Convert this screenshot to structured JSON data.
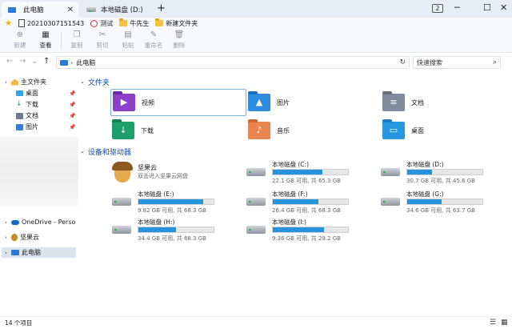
{
  "tabs": [
    {
      "label": "此电脑",
      "active": true
    },
    {
      "label": "本地磁盘 (D:)",
      "active": false
    }
  ],
  "tab_count": "2",
  "quick_access": [
    "20210307151543",
    "测试",
    "牛先生",
    "新建文件夹"
  ],
  "toolbar": {
    "new": "新建",
    "view": "查看",
    "copy": "复制",
    "cut": "剪切",
    "paste": "粘贴",
    "rename": "重命名",
    "delete": "删除"
  },
  "address": {
    "path": "此电脑",
    "search_placeholder": "快速搜索"
  },
  "sidebar": {
    "home": "主文件夹",
    "pinned": [
      "桌面",
      "下载",
      "文档",
      "图片"
    ],
    "onedrive": "OneDrive - Personal",
    "nutstore": "坚果云",
    "this_pc": "此电脑"
  },
  "groups": {
    "folders": "文件夹",
    "drives": "设备和驱动器"
  },
  "folders": [
    "视频",
    "图片",
    "文档",
    "下载",
    "音乐",
    "桌面"
  ],
  "nutstore": {
    "name": "坚果云",
    "sub": "双击进入坚果云网盘"
  },
  "drives": [
    {
      "name": "本地磁盘 (C:)",
      "info": "22.1 GB 可用, 共 65.3 GB",
      "used": 0.66
    },
    {
      "name": "本地磁盘 (D:)",
      "info": "30.7 GB 可用, 共 45.6 GB",
      "used": 0.33
    },
    {
      "name": "本地磁盘 (E:)",
      "info": "9.82 GB 可用, 共 68.3 GB",
      "used": 0.86
    },
    {
      "name": "本地磁盘 (F:)",
      "info": "26.4 GB 可用, 共 68.3 GB",
      "used": 0.61
    },
    {
      "name": "本地磁盘 (G:)",
      "info": "34.6 GB 可用, 共 63.7 GB",
      "used": 0.46
    },
    {
      "name": "本地磁盘 (H:)",
      "info": "34.4 GB 可用, 共 68.3 GB",
      "used": 0.5
    },
    {
      "name": "本地磁盘 (I:)",
      "info": "9.36 GB 可用, 共 29.2 GB",
      "used": 0.68
    }
  ],
  "status": {
    "count": "14 个项目"
  },
  "colors": {
    "accent": "#2495dd",
    "group_heading": "#1a4ea6"
  }
}
